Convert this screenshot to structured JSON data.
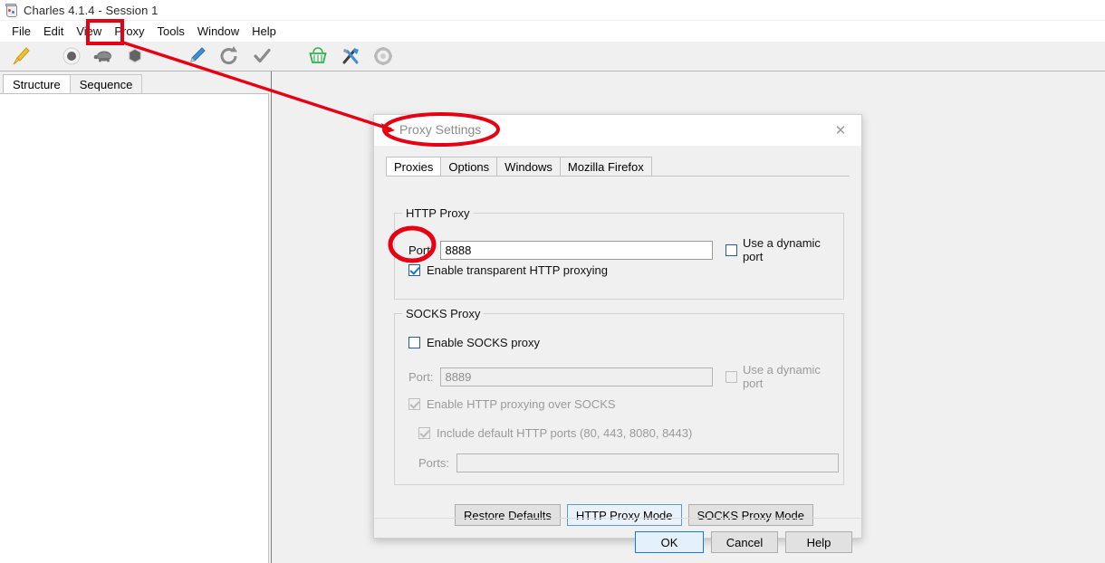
{
  "app": {
    "title": "Charles 4.1.4 - Session 1",
    "icon": "charles-app-icon",
    "menu": [
      "File",
      "Edit",
      "View",
      "Proxy",
      "Tools",
      "Window",
      "Help"
    ],
    "toolbar_icons": [
      "broom-icon",
      "record-icon",
      "throttle-turtle-icon",
      "stop-hexagon-icon",
      "compose-pen-icon",
      "refresh-icon",
      "validate-check-icon",
      "repeat-basket-icon",
      "tools-icon",
      "settings-gear-icon"
    ],
    "tabs": [
      {
        "label": "Structure",
        "selected": true
      },
      {
        "label": "Sequence",
        "selected": false
      }
    ]
  },
  "dialog": {
    "title": "Proxy Settings",
    "close_icon": "close-icon",
    "tabs": [
      {
        "label": "Proxies",
        "selected": true
      },
      {
        "label": "Options",
        "selected": false
      },
      {
        "label": "Windows",
        "selected": false
      },
      {
        "label": "Mozilla Firefox",
        "selected": false
      }
    ],
    "http_proxy": {
      "group_title": "HTTP Proxy",
      "port_label": "Port:",
      "port_value": "8888",
      "dynamic_port_label": "Use a dynamic port",
      "dynamic_port_checked": false,
      "transparent_label": "Enable transparent HTTP proxying",
      "transparent_checked": true
    },
    "socks_proxy": {
      "group_title": "SOCKS Proxy",
      "enable_label": "Enable SOCKS proxy",
      "enable_checked": false,
      "port_label": "Port:",
      "port_value": "8889",
      "dynamic_port_label": "Use a dynamic port",
      "dynamic_port_checked": false,
      "http_over_socks_label": "Enable HTTP proxying over SOCKS",
      "http_over_socks_checked": true,
      "include_default_label": "Include default HTTP ports (80, 443, 8080, 8443)",
      "include_default_checked": true,
      "ports_label": "Ports:",
      "ports_value": "",
      "ports_placeholder": ""
    },
    "mode_buttons": [
      {
        "label": "Restore Defaults",
        "focused": false
      },
      {
        "label": "HTTP Proxy Mode",
        "focused": true
      },
      {
        "label": "SOCKS Proxy Mode",
        "focused": false
      }
    ],
    "action_buttons": [
      {
        "label": "OK",
        "default": true
      },
      {
        "label": "Cancel",
        "default": false
      },
      {
        "label": "Help",
        "default": false
      }
    ]
  },
  "annotations": {
    "color": "#e60012",
    "highlight_menu": "Proxy",
    "items": [
      "proxy-menu-highlight-rect",
      "pointer-arrow-line",
      "dialog-title-ellipse",
      "transparent-checkbox-ellipse"
    ]
  }
}
